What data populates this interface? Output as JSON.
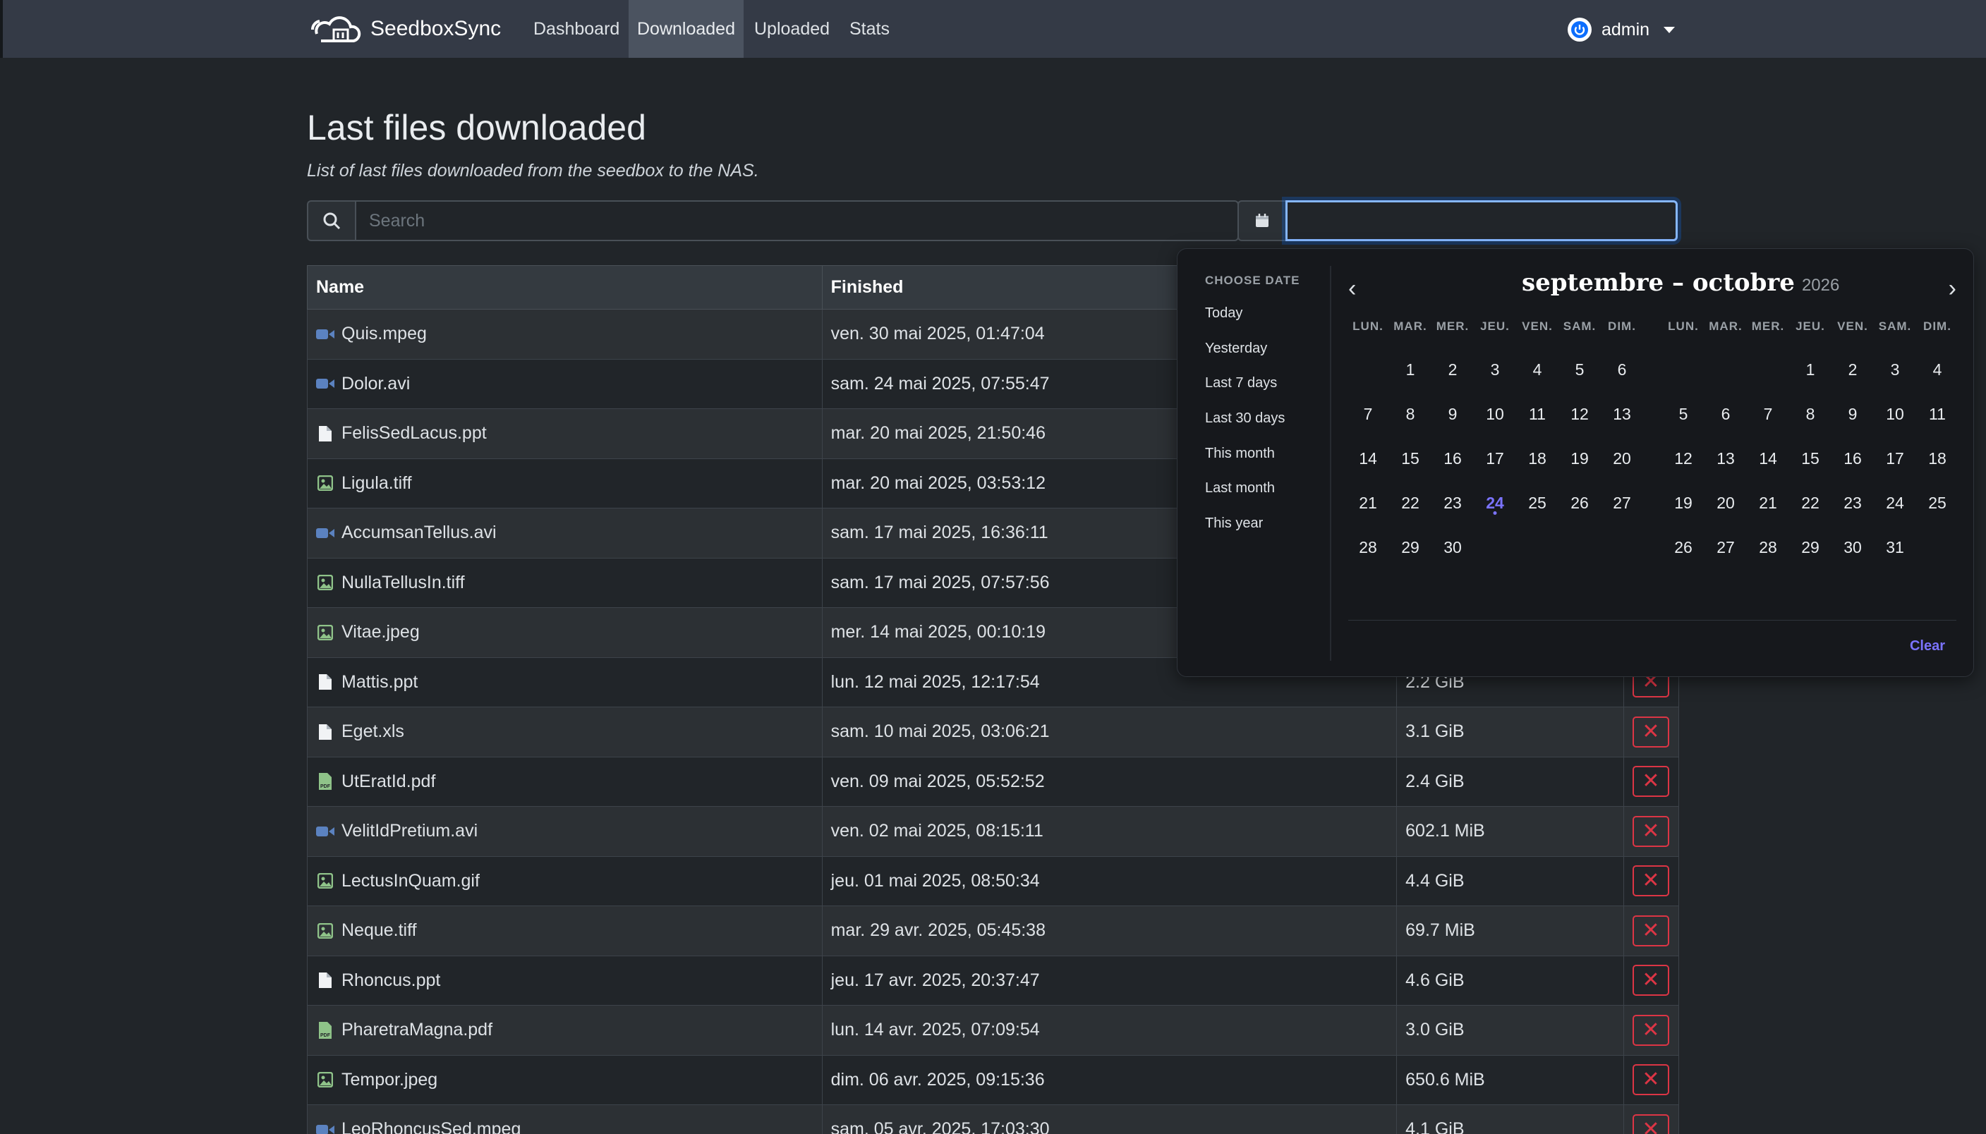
{
  "app": {
    "brand": "SeedboxSync",
    "user": "admin"
  },
  "nav": [
    {
      "label": "Dashboard",
      "active": false
    },
    {
      "label": "Downloaded",
      "active": true
    },
    {
      "label": "Uploaded",
      "active": false
    },
    {
      "label": "Stats",
      "active": false
    }
  ],
  "page": {
    "title": "Last files downloaded",
    "subtitle": "List of last files downloaded from the seedbox to the NAS.",
    "search_placeholder": "Search",
    "date_value": ""
  },
  "table": {
    "headers": [
      "Name",
      "Finished",
      "",
      ""
    ],
    "rows": [
      {
        "name": "Quis.mpeg",
        "icon": "video-icon",
        "finished": "ven. 30 mai 2025, 01:47:04",
        "size": ""
      },
      {
        "name": "Dolor.avi",
        "icon": "video-icon",
        "finished": "sam. 24 mai 2025, 07:55:47",
        "size": ""
      },
      {
        "name": "FelisSedLacus.ppt",
        "icon": "file-icon",
        "finished": "mar. 20 mai 2025, 21:50:46",
        "size": ""
      },
      {
        "name": "Ligula.tiff",
        "icon": "image-icon",
        "finished": "mar. 20 mai 2025, 03:53:12",
        "size": ""
      },
      {
        "name": "AccumsanTellus.avi",
        "icon": "video-icon",
        "finished": "sam. 17 mai 2025, 16:36:11",
        "size": ""
      },
      {
        "name": "NullaTellusIn.tiff",
        "icon": "image-icon",
        "finished": "sam. 17 mai 2025, 07:57:56",
        "size": ""
      },
      {
        "name": "Vitae.jpeg",
        "icon": "image-icon",
        "finished": "mer. 14 mai 2025, 00:10:19",
        "size": ""
      },
      {
        "name": "Mattis.ppt",
        "icon": "file-icon",
        "finished": "lun. 12 mai 2025, 12:17:54",
        "size": "2.2 GiB"
      },
      {
        "name": "Eget.xls",
        "icon": "file-icon",
        "finished": "sam. 10 mai 2025, 03:06:21",
        "size": "3.1 GiB"
      },
      {
        "name": "UtEratId.pdf",
        "icon": "pdf-icon",
        "finished": "ven. 09 mai 2025, 05:52:52",
        "size": "2.4 GiB"
      },
      {
        "name": "VelitIdPretium.avi",
        "icon": "video-icon",
        "finished": "ven. 02 mai 2025, 08:15:11",
        "size": "602.1 MiB"
      },
      {
        "name": "LectusInQuam.gif",
        "icon": "image-icon",
        "finished": "jeu. 01 mai 2025, 08:50:34",
        "size": "4.4 GiB"
      },
      {
        "name": "Neque.tiff",
        "icon": "image-icon",
        "finished": "mar. 29 avr. 2025, 05:45:38",
        "size": "69.7 MiB"
      },
      {
        "name": "Rhoncus.ppt",
        "icon": "file-icon",
        "finished": "jeu. 17 avr. 2025, 20:37:47",
        "size": "4.6 GiB"
      },
      {
        "name": "PharetraMagna.pdf",
        "icon": "pdf-icon",
        "finished": "lun. 14 avr. 2025, 07:09:54",
        "size": "3.0 GiB"
      },
      {
        "name": "Tempor.jpeg",
        "icon": "image-icon",
        "finished": "dim. 06 avr. 2025, 09:15:36",
        "size": "650.6 MiB"
      },
      {
        "name": "LeoRhoncusSed.mpeg",
        "icon": "video-icon",
        "finished": "sam. 05 avr. 2025, 17:03:30",
        "size": "4.1 GiB"
      }
    ]
  },
  "datepicker": {
    "presets_header": "CHOOSE DATE",
    "presets": [
      "Today",
      "Yesterday",
      "Last 7 days",
      "Last 30 days",
      "This month",
      "Last month",
      "This year"
    ],
    "title": "septembre – octobre",
    "year": "2026",
    "weekdays": [
      "LUN.",
      "MAR.",
      "MER.",
      "JEU.",
      "VEN.",
      "SAM.",
      "DIM."
    ],
    "months": [
      {
        "name": "septembre",
        "offset": 1,
        "days": 30,
        "today": 24
      },
      {
        "name": "octobre",
        "offset": 3,
        "days": 31,
        "today": null
      }
    ],
    "clear_label": "Clear"
  },
  "colors": {
    "accent": "#7b73ff",
    "danger": "#dc3545",
    "video": "#5b82c0",
    "image": "#8fc389",
    "pdf": "#8fc389"
  }
}
